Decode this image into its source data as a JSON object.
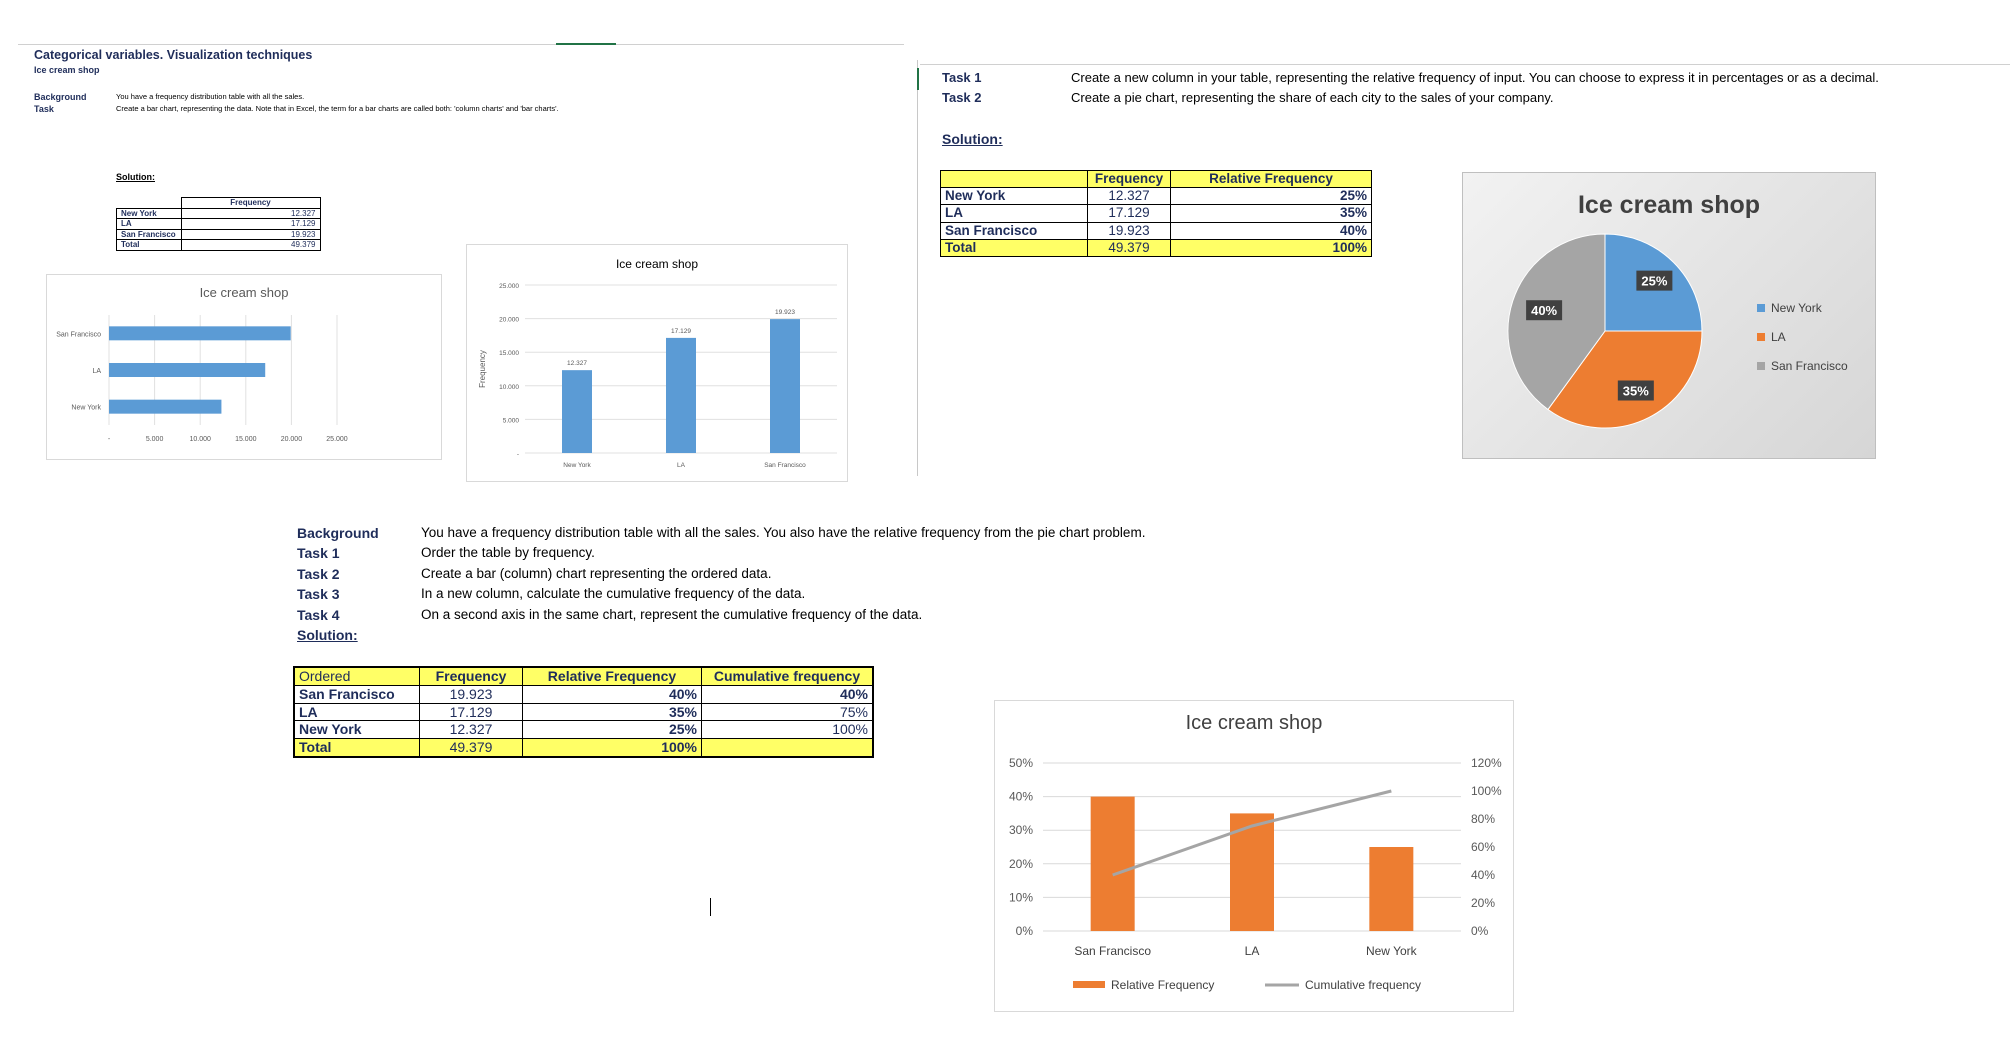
{
  "p1": {
    "title": "Categorical variables. Visualization techniques",
    "subtitle": "Ice cream shop",
    "background_label": "Background",
    "task_label": "Task",
    "background_text": "You have a frequency distribution table with all the sales.",
    "task_text": "Create a bar chart, representing the data. Note that in Excel, the term for a bar charts are called both: 'column charts' and 'bar charts'.",
    "solution_label": "Solution:",
    "table": {
      "header": "Frequency",
      "rows": [
        {
          "city": "New York",
          "freq": "12.327"
        },
        {
          "city": "LA",
          "freq": "17.129"
        },
        {
          "city": "San Francisco",
          "freq": "19.923"
        },
        {
          "city": "Total",
          "freq": "49.379"
        }
      ]
    }
  },
  "p2": {
    "task1_label": "Task 1",
    "task1_text": "Create a new column in your table, representing the relative frequency of input. You can choose to express it in percentages or as a decimal.",
    "task2_label": "Task 2",
    "task2_text": "Create a pie chart, representing the share of each city to the sales of your company.",
    "solution_label": "Solution:",
    "table": {
      "headers": [
        "Frequency",
        "Relative Frequency"
      ],
      "rows": [
        {
          "city": "New York",
          "freq": "12.327",
          "rel": "25%"
        },
        {
          "city": "LA",
          "freq": "17.129",
          "rel": "35%"
        },
        {
          "city": "San Francisco",
          "freq": "19.923",
          "rel": "40%"
        },
        {
          "city": "Total",
          "freq": "49.379",
          "rel": "100%"
        }
      ]
    }
  },
  "p3": {
    "labels": [
      "Background",
      "Task 1",
      "Task 2",
      "Task 3",
      "Task 4"
    ],
    "texts": [
      "You have a frequency distribution table with all the sales. You also have the relative frequency from the pie chart problem.",
      "Order the table by frequency.",
      "Create a bar (column) chart representing the ordered data.",
      "In a new column, calculate the cumulative frequency of the data.",
      "On a second axis in the same chart, represent the cumulative frequency of the data."
    ],
    "solution_label": "Solution:",
    "table": {
      "headers": [
        "Ordered",
        "Frequency",
        "Relative Frequency",
        "Cumulative frequency"
      ],
      "rows": [
        {
          "city": "San Francisco",
          "freq": "19.923",
          "rel": "40%",
          "cum": "40%"
        },
        {
          "city": "LA",
          "freq": "17.129",
          "rel": "35%",
          "cum": "75%"
        },
        {
          "city": "New York",
          "freq": "12.327",
          "rel": "25%",
          "cum": "100%"
        },
        {
          "city": "Total",
          "freq": "49.379",
          "rel": "100%",
          "cum": ""
        }
      ]
    }
  },
  "chart_data": [
    {
      "id": "hbar",
      "type": "bar",
      "orientation": "horizontal",
      "title": "Ice cream shop",
      "categories": [
        "New York",
        "LA",
        "San Francisco"
      ],
      "values": [
        12327,
        17129,
        19923
      ],
      "xlim": [
        0,
        25000
      ],
      "ticks": [
        "-",
        "5.000",
        "10.000",
        "15.000",
        "20.000",
        "25.000"
      ],
      "color": "#5b9bd5",
      "grid": true
    },
    {
      "id": "vbar",
      "type": "bar",
      "orientation": "vertical",
      "title": "Ice cream shop",
      "ylabel": "Frequency",
      "categories": [
        "New York",
        "LA",
        "San Francisco"
      ],
      "values": [
        12327,
        17129,
        19923
      ],
      "data_labels": [
        "12.327",
        "17.129",
        "19.923"
      ],
      "ylim": [
        0,
        25000
      ],
      "ticks": [
        "-",
        "5.000",
        "10.000",
        "15.000",
        "20.000",
        "25.000"
      ],
      "color": "#5b9bd5",
      "grid": true
    },
    {
      "id": "pie",
      "type": "pie",
      "title": "Ice cream shop",
      "categories": [
        "New York",
        "LA",
        "San Francisco"
      ],
      "values": [
        25,
        35,
        40
      ],
      "data_labels": [
        "25%",
        "35%",
        "40%"
      ],
      "colors": [
        "#5b9bd5",
        "#ed7d31",
        "#a5a5a5"
      ],
      "legend": "right"
    },
    {
      "id": "combo",
      "type": "bar",
      "title": "Ice cream shop",
      "categories": [
        "San Francisco",
        "LA",
        "New York"
      ],
      "series": [
        {
          "name": "Relative Frequency",
          "type": "bar",
          "values": [
            40,
            35,
            25
          ],
          "color": "#ed7d31",
          "axis": "left"
        },
        {
          "name": "Cumulative frequency",
          "type": "line",
          "values": [
            40,
            75,
            100
          ],
          "color": "#a5a5a5",
          "axis": "right"
        }
      ],
      "ylim": [
        0,
        50
      ],
      "y2lim": [
        0,
        120
      ],
      "ticks_left": [
        "0%",
        "10%",
        "20%",
        "30%",
        "40%",
        "50%"
      ],
      "ticks_right": [
        "0%",
        "20%",
        "40%",
        "60%",
        "80%",
        "100%",
        "120%"
      ],
      "legend": "bottom",
      "grid": true
    }
  ]
}
